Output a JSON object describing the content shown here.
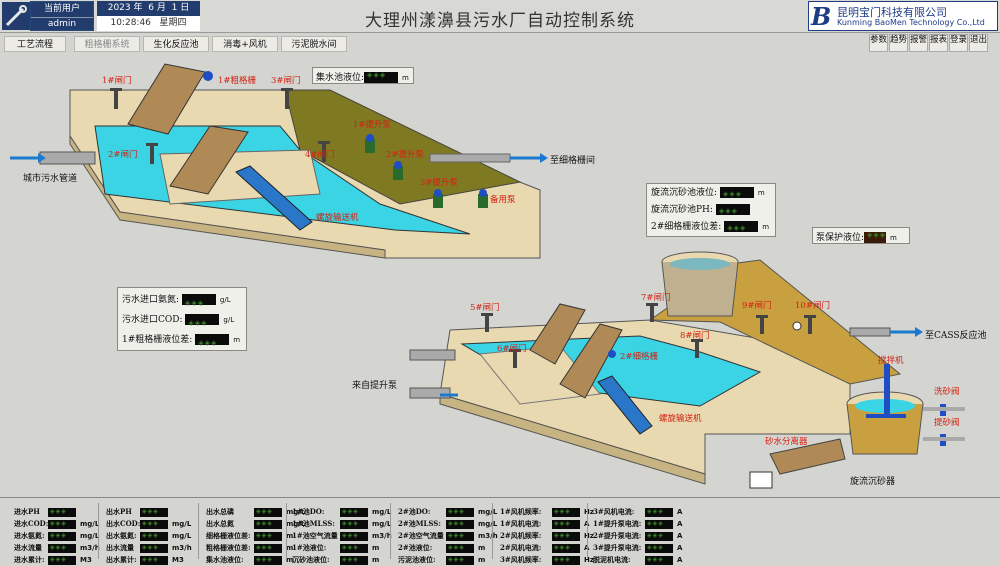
{
  "header": {
    "user_label": "当前用户",
    "user_name": "admin",
    "year": "2023",
    "year_unit": "年",
    "month": "6",
    "month_unit": "月",
    "day": "1",
    "day_unit": "日",
    "time": "10:28:46",
    "weekday": "星期四",
    "title": "大理州漾濞县污水厂自动控制系统",
    "company_cn": "昆明宝门科技有限公司",
    "company_en": "Kunming BaoMen Technology Co.,Ltd",
    "logo_letter": "B"
  },
  "nav": {
    "tabs": [
      "工艺流程",
      "粗格栅系统",
      "生化反应池",
      "消毒+风机",
      "污泥脱水间"
    ]
  },
  "right_buttons": [
    "参数",
    "趋势",
    "报警",
    "报表",
    "登录",
    "退出"
  ],
  "process": {
    "labels": {
      "gate1a": "1#闸门",
      "coarse1": "1#粗格栅",
      "gate3": "3#闸门",
      "gate2": "2#闸门",
      "gate4": "4#闸门",
      "pump_lift1": "1#提升泵",
      "pump_lift2": "2#提升泵",
      "pump_lift3": "3#提升泵",
      "pump_backup": "备用泵",
      "screw1": "螺旋输送机",
      "to_fine": "至细格栅间",
      "city_pipe": "城市污水管道",
      "from_pump": "来自提升泵",
      "gate5": "5#闸门",
      "gate6": "6#闸门",
      "coarse2": "2#细格栅",
      "gate7": "7#闸门",
      "gate8": "8#闸门",
      "gate9": "9#闸门",
      "gate10": "10#闸门",
      "to_cass": "至CASS反应池",
      "mixer": "搅拌机",
      "sand_valve": "洗砂阀",
      "lift_sand_valve": "提砂阀",
      "screw2": "螺旋输送机",
      "sand_sep": "砂水分离器",
      "grit_tank": "旋流沉砂器"
    },
    "level_box": {
      "label": "集水池液位:",
      "unit": "m"
    },
    "influent": [
      {
        "label": "污水进口氨氮:",
        "unit": "g/L"
      },
      {
        "label": "污水进口COD:",
        "unit": "g/L"
      },
      {
        "label": "1#粗格栅液位差:",
        "unit": "m"
      }
    ],
    "grit_box": [
      {
        "label": "旋流沉砂池液位:",
        "unit": "m"
      },
      {
        "label": "旋流沉砂池PH:",
        "unit": ""
      },
      {
        "label": "2#细格栅液位差:",
        "unit": "m"
      }
    ],
    "pump_protect": {
      "label": "泵保护液位:",
      "unit": "m"
    }
  },
  "bottom": {
    "cols": [
      [
        {
          "l": "进水PH",
          "u": ""
        },
        {
          "l": "进水COD:",
          "u": "mg/L"
        },
        {
          "l": "进水氨氮:",
          "u": "mg/L"
        },
        {
          "l": "进水流量",
          "u": "m3/h"
        },
        {
          "l": "进水累计:",
          "u": "M3"
        }
      ],
      [
        {
          "l": "出水PH",
          "u": ""
        },
        {
          "l": "出水COD:",
          "u": "mg/L"
        },
        {
          "l": "出水氨氮:",
          "u": "mg/L"
        },
        {
          "l": "出水流量",
          "u": "m3/h"
        },
        {
          "l": "出水累计:",
          "u": "M3"
        }
      ],
      [
        {
          "l": "出水总磷",
          "u": "mg/L"
        },
        {
          "l": "出水总氮",
          "u": "mg/L"
        },
        {
          "l": "细格栅液位差:",
          "u": "m"
        },
        {
          "l": "粗格栅液位差:",
          "u": "m"
        },
        {
          "l": "集水池液位:",
          "u": "m"
        }
      ],
      [
        {
          "l": "1#池DO:",
          "u": "mg/L"
        },
        {
          "l": "1#池MLSS:",
          "u": "mg/L"
        },
        {
          "l": "1#池空气流量",
          "u": "m3/h"
        },
        {
          "l": "1#池液位:",
          "u": "m"
        },
        {
          "l": "沉砂池液位:",
          "u": "m"
        }
      ],
      [
        {
          "l": "2#池DO:",
          "u": "mg/L"
        },
        {
          "l": "2#池MLSS:",
          "u": "mg/L"
        },
        {
          "l": "2#池空气流量",
          "u": "m3/h"
        },
        {
          "l": "2#池液位:",
          "u": "m"
        },
        {
          "l": "污泥池液位:",
          "u": "m"
        }
      ],
      [
        {
          "l": "1#风机频率:",
          "u": "Hz"
        },
        {
          "l": "1#风机电流:",
          "u": "A"
        },
        {
          "l": "2#风机频率:",
          "u": "Hz"
        },
        {
          "l": "2#风机电流:",
          "u": "A"
        },
        {
          "l": "3#风机频率:",
          "u": "Hz"
        }
      ],
      [
        {
          "l": "3#风机电流:",
          "u": "A"
        },
        {
          "l": "1#提升泵电流:",
          "u": "A"
        },
        {
          "l": "2#提升泵电流:",
          "u": "A"
        },
        {
          "l": "3#提升泵电流:",
          "u": "A"
        },
        {
          "l": "脱泥机电流:",
          "u": "A"
        }
      ]
    ]
  }
}
